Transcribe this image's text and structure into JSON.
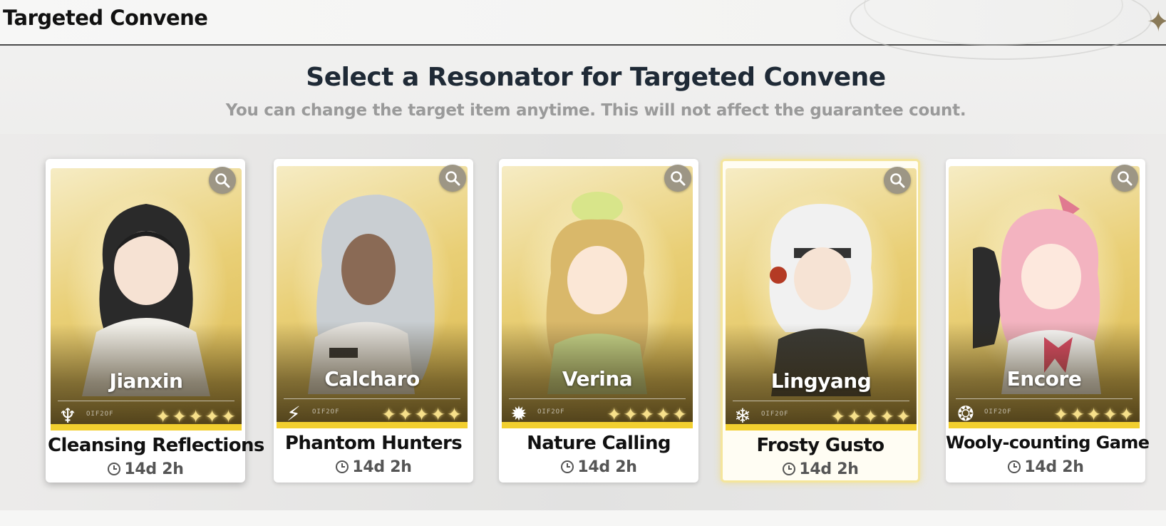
{
  "header": {
    "title": "Targeted Convene"
  },
  "main": {
    "heading": "Select a Resonator for Targeted Convene",
    "subheading": "You can change the target item anytime. This will not affect the guarantee count."
  },
  "colors": {
    "gold": "#f2cf2f",
    "zoom_button": "#9d9685",
    "heading": "#1f2a36"
  },
  "cards": [
    {
      "name": "Jianxin",
      "banner": "Cleansing Reflections",
      "timer": "14d 2h",
      "stars": "✦✦✦✦✦",
      "element_icon": "aero-icon",
      "element_glyph": "♆",
      "code": "OIF2OF"
    },
    {
      "name": "Calcharo",
      "banner": "Phantom Hunters",
      "timer": "14d 2h",
      "stars": "✦✦✦✦✦",
      "element_icon": "electro-icon",
      "element_glyph": "⚡",
      "code": "OIF2OF"
    },
    {
      "name": "Verina",
      "banner": "Nature Calling",
      "timer": "14d 2h",
      "stars": "✦✦✦✦✦",
      "element_icon": "spectro-icon",
      "element_glyph": "✹",
      "code": "OIF2OF"
    },
    {
      "name": "Lingyang",
      "banner": "Frosty Gusto",
      "timer": "14d 2h",
      "stars": "✦✦✦✦✦",
      "element_icon": "glacio-icon",
      "element_glyph": "❄",
      "code": "OIF2OF"
    },
    {
      "name": "Encore",
      "banner": "Wooly-counting Game",
      "timer": "14d 2h",
      "stars": "✦✦✦✦✦",
      "element_icon": "fusion-icon",
      "element_glyph": "❂",
      "code": "OIF2OF"
    }
  ]
}
